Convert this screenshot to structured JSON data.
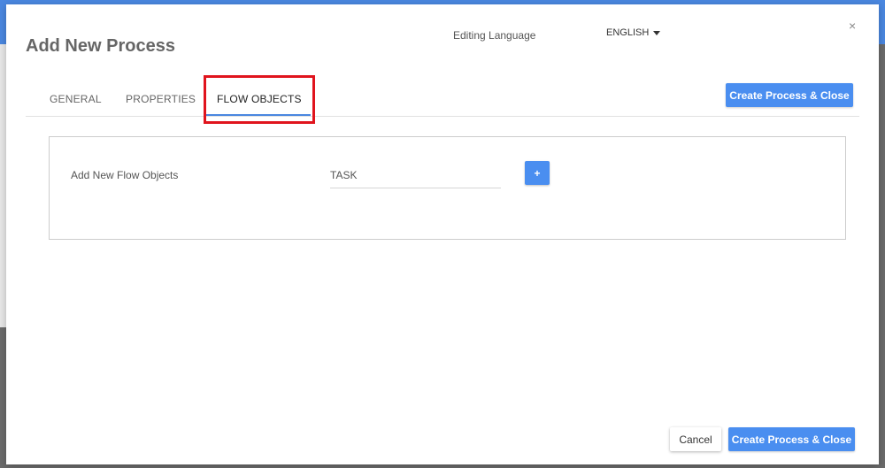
{
  "modal": {
    "title": "Add New Process",
    "close_icon": "×"
  },
  "language": {
    "label": "Editing Language",
    "selected": "ENGLISH"
  },
  "tabs": [
    {
      "label": "GENERAL",
      "active": false
    },
    {
      "label": "PROPERTIES",
      "active": false
    },
    {
      "label": "FLOW OBJECTS",
      "active": true
    }
  ],
  "header_actions": {
    "create_close_label": "Create Process & Close"
  },
  "flow_objects": {
    "label": "Add New Flow Objects",
    "input_value": "TASK",
    "add_label": "+"
  },
  "footer": {
    "cancel_label": "Cancel",
    "create_close_label": "Create Process & Close"
  },
  "colors": {
    "accent": "#4a8ef0",
    "highlight": "#e0141d"
  }
}
